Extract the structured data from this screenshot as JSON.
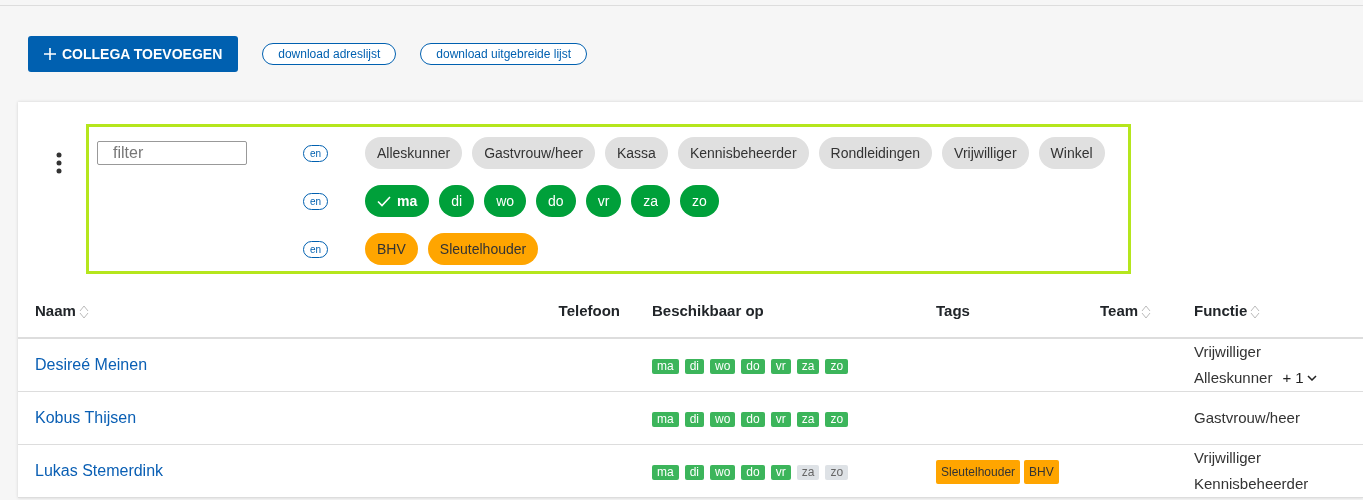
{
  "actions": {
    "add_button": "COLLEGA TOEVOEGEN",
    "links": [
      "download adreslijst",
      "download uitgebreide lijst"
    ]
  },
  "filter": {
    "placeholder": "filter",
    "groups": [
      {
        "operator": "en",
        "kind": "function",
        "chips": [
          {
            "label": "Alleskunner",
            "selected": false
          },
          {
            "label": "Gastvrouw/heer",
            "selected": false
          },
          {
            "label": "Kassa",
            "selected": false
          },
          {
            "label": "Kennisbeheerder",
            "selected": false
          },
          {
            "label": "Rondleidingen",
            "selected": false
          },
          {
            "label": "Vrijwilliger",
            "selected": false
          },
          {
            "label": "Winkel",
            "selected": false
          }
        ]
      },
      {
        "operator": "en",
        "kind": "day",
        "chips": [
          {
            "label": "ma",
            "selected": true
          },
          {
            "label": "di",
            "selected": false
          },
          {
            "label": "wo",
            "selected": false
          },
          {
            "label": "do",
            "selected": false
          },
          {
            "label": "vr",
            "selected": false
          },
          {
            "label": "za",
            "selected": false
          },
          {
            "label": "zo",
            "selected": false
          }
        ]
      },
      {
        "operator": "en",
        "kind": "tag",
        "chips": [
          {
            "label": "BHV",
            "selected": false
          },
          {
            "label": "Sleutelhouder",
            "selected": false
          }
        ]
      }
    ]
  },
  "table": {
    "columns": [
      {
        "label": "Naam",
        "sortable": true
      },
      {
        "label": "Telefoon",
        "sortable": false
      },
      {
        "label": "Beschikbaar op",
        "sortable": false
      },
      {
        "label": "Tags",
        "sortable": false
      },
      {
        "label": "Team",
        "sortable": true
      },
      {
        "label": "Functie",
        "sortable": true
      }
    ],
    "rows": [
      {
        "name": "Desireé Meinen",
        "days": [
          {
            "label": "ma",
            "available": true
          },
          {
            "label": "di",
            "available": true
          },
          {
            "label": "wo",
            "available": true
          },
          {
            "label": "do",
            "available": true
          },
          {
            "label": "vr",
            "available": true
          },
          {
            "label": "za",
            "available": true
          },
          {
            "label": "zo",
            "available": true
          }
        ],
        "tags": [],
        "functions": [
          "Vrijwilliger",
          "Alleskunner"
        ],
        "more": "+ 1"
      },
      {
        "name": "Kobus Thijsen",
        "days": [
          {
            "label": "ma",
            "available": true
          },
          {
            "label": "di",
            "available": true
          },
          {
            "label": "wo",
            "available": true
          },
          {
            "label": "do",
            "available": true
          },
          {
            "label": "vr",
            "available": true
          },
          {
            "label": "za",
            "available": true
          },
          {
            "label": "zo",
            "available": true
          }
        ],
        "tags": [],
        "functions": [
          "Gastvrouw/heer"
        ]
      },
      {
        "name": "Lukas Stemerdink",
        "days": [
          {
            "label": "ma",
            "available": true
          },
          {
            "label": "di",
            "available": true
          },
          {
            "label": "wo",
            "available": true
          },
          {
            "label": "do",
            "available": true
          },
          {
            "label": "vr",
            "available": true
          },
          {
            "label": "za",
            "available": false
          },
          {
            "label": "zo",
            "available": false
          }
        ],
        "tags": [
          "Sleutelhouder",
          "BHV"
        ],
        "functions": [
          "Vrijwilliger",
          "Kennisbeheerder"
        ]
      }
    ]
  }
}
